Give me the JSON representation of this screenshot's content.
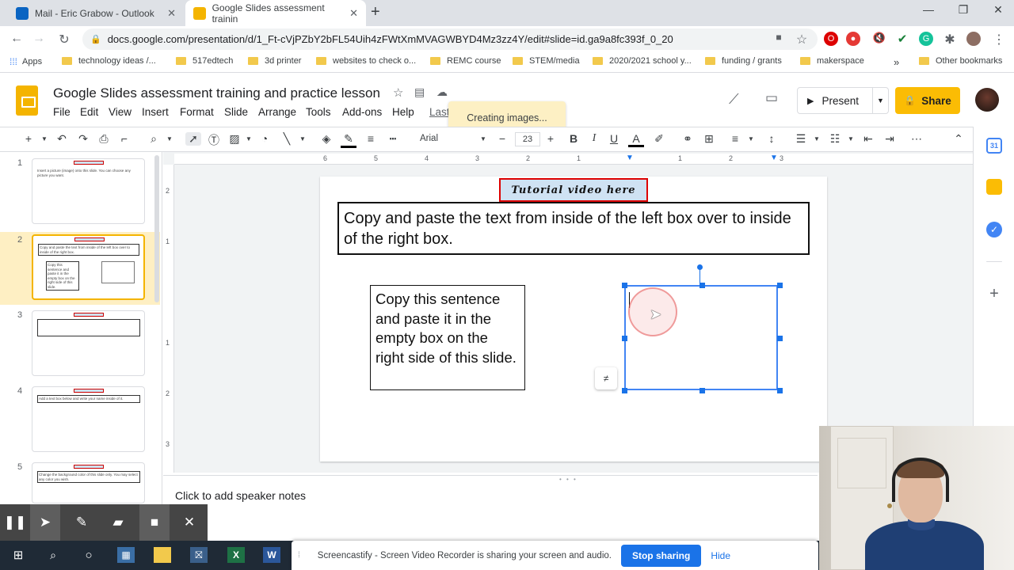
{
  "browser": {
    "tabs": [
      {
        "title": "Mail - Eric Grabow - Outlook",
        "favicon_color": "#0a64c2"
      },
      {
        "title": "Google Slides assessment trainin",
        "favicon_color": "#f4b400"
      }
    ],
    "url": "docs.google.com/presentation/d/1_Ft-cVjPZbY2bFL54Uih4zFWtXmMVAGWBYD4Mz3zz4Y/edit#slide=id.ga9a8fc393f_0_20",
    "bookmarks": [
      "Apps",
      "technology ideas /...",
      "517edtech",
      "3d printer",
      "websites to check o...",
      "REMC course",
      "STEM/media",
      "2020/2021 school y...",
      "funding / grants",
      "makerspace",
      "Other bookmarks"
    ],
    "bookmarks_more": "»"
  },
  "slides": {
    "title": "Google Slides assessment training and practice lesson",
    "menu": [
      "File",
      "Edit",
      "View",
      "Insert",
      "Format",
      "Slide",
      "Arrange",
      "Tools",
      "Add-ons",
      "Help",
      "Last"
    ],
    "toast": "Creating images...",
    "present_label": "Present",
    "share_label": "Share",
    "font_name": "Arial",
    "font_size": "23",
    "ruler_top": [
      "6",
      "5",
      "4",
      "3",
      "2",
      "1",
      "1",
      "2",
      "3"
    ],
    "ruler_left": [
      "2",
      "1",
      "1",
      "2",
      "3"
    ]
  },
  "filmstrip": {
    "numbers": [
      "1",
      "2",
      "3",
      "4",
      "5"
    ],
    "thumb1_text": "Insert a picture (image) onto this slide. You can choose any picture you want.",
    "thumb2_text": "Copy and paste the text from inside of the left box over to inside of the right box.",
    "thumb2_box": "Copy this sentence and paste it in the empty box on the right side of this slide.",
    "thumb4_text": "Add a text box below and write your name inside of it.",
    "thumb5_text": "Change the background color of this slide only. You may select any color you wish."
  },
  "slide": {
    "tutorial_label": "Tutorial video here",
    "instruction": "Copy and paste the text from inside of the left box over to inside of the right box.",
    "left_box": "Copy this sentence and paste it in the empty box on the right side of this slide."
  },
  "notes": {
    "placeholder": "Click to add speaker notes"
  },
  "screencastify": {
    "share_text": "Screencastify - Screen Video Recorder is sharing your screen and audio.",
    "stop_label": "Stop sharing",
    "hide_label": "Hide"
  }
}
